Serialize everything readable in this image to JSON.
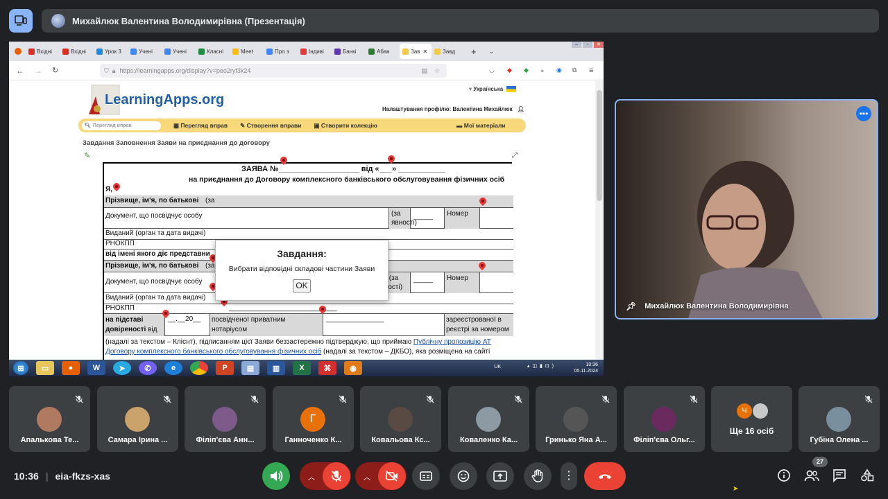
{
  "meeting": {
    "presenter_title": "Михайлюк Валентина Володимирівна (Презентація)",
    "time": "10:36",
    "code": "eia-fkzs-xas",
    "participant_count": "27"
  },
  "browser": {
    "tabs": [
      {
        "label": "Вхідні",
        "color": "#d93025"
      },
      {
        "label": "Вхідні",
        "color": "#d93025"
      },
      {
        "label": "Урок 3",
        "color": "#1e88e5"
      },
      {
        "label": "Учені",
        "color": "#4285f4"
      },
      {
        "label": "Учені",
        "color": "#4285f4"
      },
      {
        "label": "Класні",
        "color": "#1e8e3e"
      },
      {
        "label": "Meet",
        "color": "#fbbc04"
      },
      {
        "label": "Про з",
        "color": "#4285f4"
      },
      {
        "label": "Індиві",
        "color": "#e53935"
      },
      {
        "label": "Банкі",
        "color": "#5e35b1"
      },
      {
        "label": "Абан",
        "color": "#2e7d32"
      },
      {
        "label": "Зав",
        "color": "#f2c94c"
      },
      {
        "label": "Завд",
        "color": "#f2c94c"
      }
    ],
    "url": "https://learningapps.org/display?v=peo2ryf3k24"
  },
  "learningapps": {
    "logo": "LearningApps.org",
    "language": "Українська",
    "profile": "Налаштування профілю: Валентина Михайлюк",
    "search_placeholder": "Перегляд вправ",
    "menu": [
      "Перегляд вправ",
      "Створення вправи",
      "Створити колекцію",
      "Мої матеріали"
    ],
    "task_heading": "Завдання Заповнення Заяви на приєднання до договору"
  },
  "document": {
    "line1_prefix": "ЗАЯВА №",
    "line1_mid": "від «",
    "line1_end": "»",
    "line2": "на приєднання до Договору комплексного банківського обслуговування фізичних осіб",
    "ya": "Я,",
    "r_pib": "Прізвище, ім'я, по батькові",
    "r_pib_note": "(за",
    "r_doc": "Документ, що посвідчує особу",
    "r_seria_a": "(за",
    "r_seria_b": "явності)",
    "r_nomer": "Номер",
    "r_vydanyi": "Виданий (орган та дата видачі)",
    "r_rnokpp": "РНОКПП",
    "r_vid_imeni": "від імені якого діє представни",
    "r_pib2": "Прізвище, ім'я, по батькові",
    "r_pib2_note": "(за наявності)",
    "r_doc2": "Документ, що посвідчує особу",
    "r_seria2": "Серія (за наявності)",
    "r_nomer2": "Номер",
    "r_vydanyi2": "Виданий (орган та дата видачі)",
    "r_rnokpp2": "РНОКПП",
    "r_na_pidstavi": "на підставі довіреності",
    "r_vid": "від",
    "r_date": "__.__20__",
    "r_posv": "посвідченої приватним нотаріусом",
    "r_zareestr": "зареєстрованої в реєстрі за номером",
    "para1a": "(надалі за текстом – Клієнт), підписанням цієї Заяви беззастережно підтверджую, що приймаю",
    "para1_link": "Публічну пропозицію АТ",
    "para2_link": "Договору комплексного банківського обслуговування фізичних осіб",
    "para2b": "(надалі за текстом – ДКБО), яка розміщена на сайті"
  },
  "dialog": {
    "title": "Завдання:",
    "text": "Вибрати відповідні складові частини Заяви",
    "ok": "OK"
  },
  "taskbar": {
    "lang": "UK",
    "clock": "10:36",
    "date": "05.11.2024"
  },
  "video": {
    "name": "Михайлюк Валентина Володимирівна"
  },
  "participants": [
    {
      "name": "Апалькова Те...",
      "avatar_color": "#b07a60",
      "initial": ""
    },
    {
      "name": "Самара Ірина ...",
      "avatar_color": "#c9a36b",
      "initial": ""
    },
    {
      "name": "Філіп'єва Анн...",
      "avatar_color": "#7c5a8a",
      "initial": ""
    },
    {
      "name": "Ганноченко К...",
      "avatar_color": "#e8710a",
      "initial": "Г"
    },
    {
      "name": "Ковальова Кс...",
      "avatar_color": "#5a4a44",
      "initial": ""
    },
    {
      "name": "Коваленко Ка...",
      "avatar_color": "#8e9aa3",
      "initial": ""
    },
    {
      "name": "Гринько Яна А...",
      "avatar_color": "#555555",
      "initial": ""
    },
    {
      "name": "Філіп'єва Ольг...",
      "avatar_color": "#6b2a5e",
      "initial": ""
    },
    {
      "name": "Ще 16 осіб",
      "avatar_color": "#e8710a",
      "initial": "Ч"
    },
    {
      "name": "Губіна Олена ...",
      "avatar_color": "#7a8f9e",
      "initial": ""
    }
  ],
  "colors": {
    "mic_on": "#34a853",
    "muted": "#ea4335",
    "muted_dark": "#8c1d18",
    "end_call": "#ea4335",
    "control_gray": "#3c4043",
    "accent": "#8ab4f8"
  }
}
